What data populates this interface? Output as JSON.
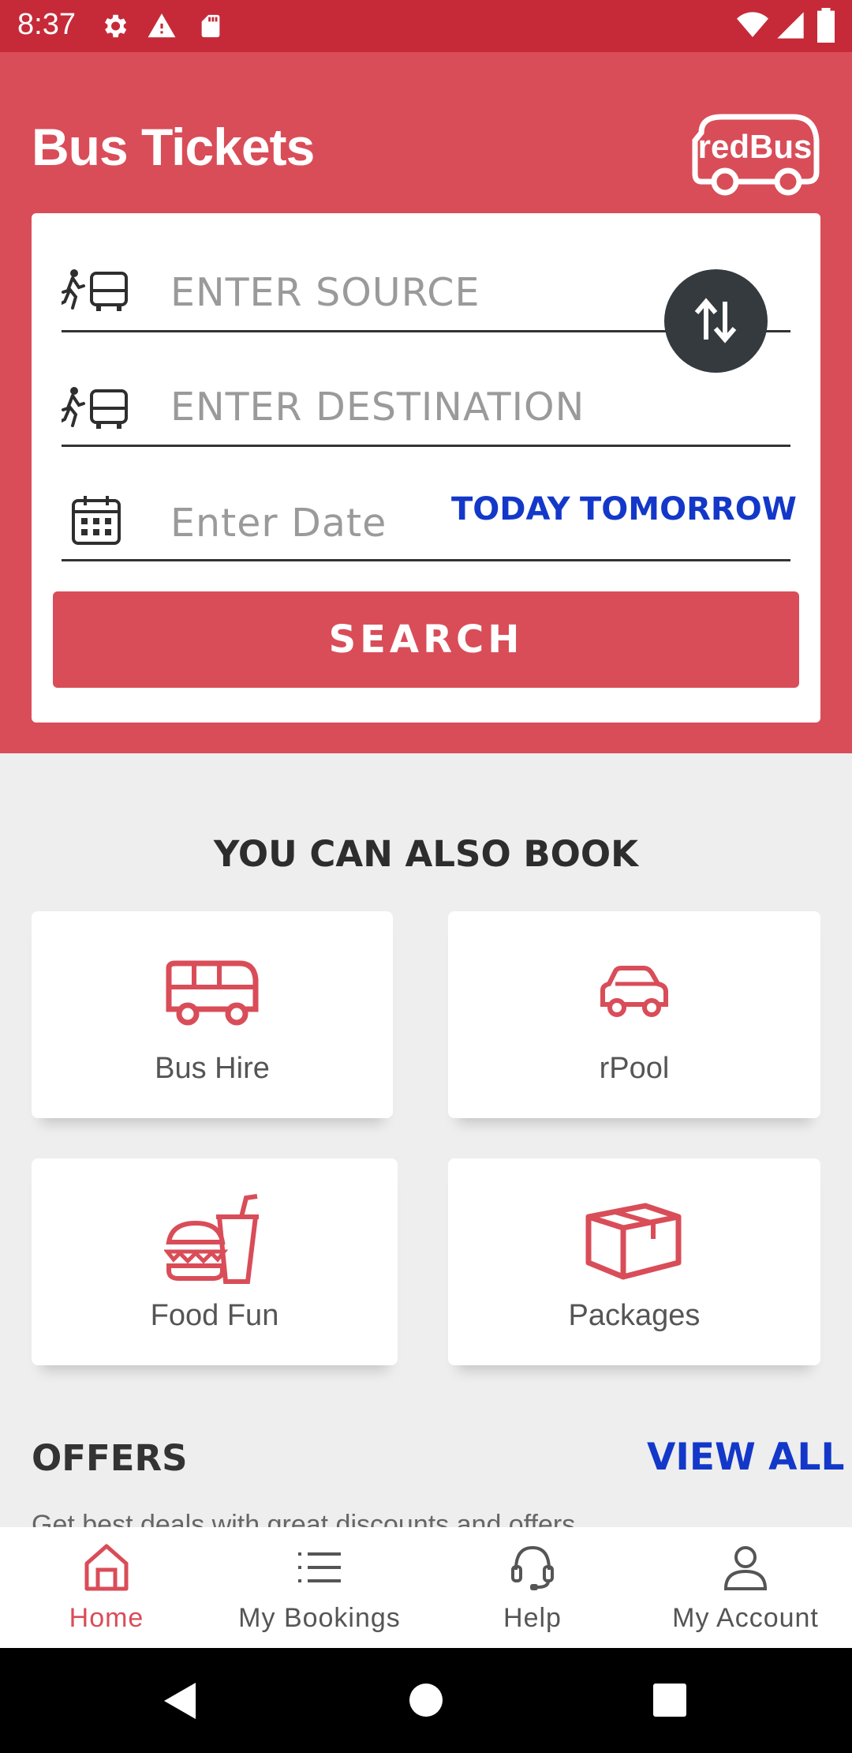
{
  "status_bar": {
    "time": "8:37",
    "icons": [
      "gear-icon",
      "warning-icon",
      "sd-card-icon",
      "wifi-icon",
      "signal-icon",
      "battery-icon"
    ]
  },
  "header": {
    "title": "Bus Tickets",
    "logo_text": "redBus",
    "background": "#d94d58"
  },
  "search_form": {
    "source_placeholder": "ENTER SOURCE",
    "destination_placeholder": "ENTER DESTINATION",
    "date_placeholder": "Enter Date",
    "today_label": "TODAY",
    "tomorrow_label": "TOMORROW",
    "search_label": "SEARCH"
  },
  "also_book": {
    "title": "YOU CAN ALSO BOOK",
    "items": [
      {
        "label": "Bus Hire",
        "icon": "bus-icon"
      },
      {
        "label": "rPool",
        "icon": "car-icon"
      },
      {
        "label": "Food Fun",
        "icon": "food-icon"
      },
      {
        "label": "Packages",
        "icon": "package-icon"
      }
    ]
  },
  "offers": {
    "title": "OFFERS",
    "view_all_label": "VIEW ALL",
    "subtitle": "Get best deals with great discounts and offers"
  },
  "bottom_nav": {
    "items": [
      {
        "label": "Home",
        "icon": "home-icon",
        "active": true
      },
      {
        "label": "My Bookings",
        "icon": "list-icon",
        "active": false
      },
      {
        "label": "Help",
        "icon": "headset-icon",
        "active": false
      },
      {
        "label": "My Account",
        "icon": "user-icon",
        "active": false
      }
    ]
  },
  "colors": {
    "accent_red": "#d94d58",
    "status_red": "#c62a38",
    "link_blue": "#1338c9"
  }
}
